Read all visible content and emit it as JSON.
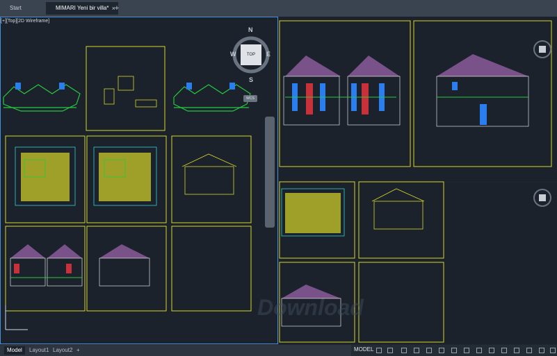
{
  "tabs": {
    "start_label": "Start",
    "active_label": "MIMARI Yeni bir villa*",
    "close_glyph": "×",
    "add_glyph": "+"
  },
  "viewport": {
    "label": "[+][Top][2D Wireframe]"
  },
  "viewcube": {
    "north": "N",
    "south": "S",
    "east": "E",
    "west": "W",
    "top": "TOP",
    "wcs": "WCS"
  },
  "layout_tabs": {
    "model": "Model",
    "layout1": "Layout1",
    "layout2": "Layout2",
    "add": "+"
  },
  "status": {
    "model": "MODEL"
  },
  "watermark": "Download"
}
